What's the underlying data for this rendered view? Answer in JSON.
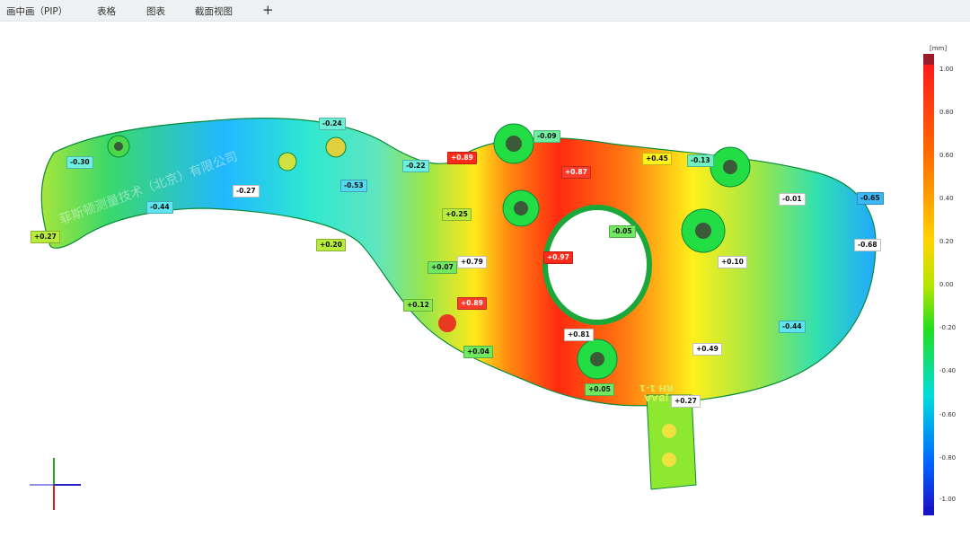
{
  "tabs": [
    "画中画（PIP）",
    "表格",
    "图表",
    "截面视图"
  ],
  "add_tab": "+",
  "watermark": "菲斯顿测量技术（北京）有限公司",
  "part_marking": [
    "JBAA",
    "RH 1-1"
  ],
  "colors": {
    "hot": "#ff2a1a",
    "warm": "#ffd400",
    "neutral": "#22dd22",
    "cold": "#1a7aff"
  },
  "scale": {
    "unit": "[mm]",
    "ticks": [
      "1.00",
      "0.80",
      "0.60",
      "0.40",
      "0.20",
      "0.00",
      "-0.20",
      "-0.40",
      "-0.60",
      "-0.80",
      "-1.00"
    ]
  },
  "deviations": [
    {
      "text": "-0.30",
      "color": "#6ef0e0"
    },
    {
      "text": "-0.44",
      "color": "#5ee6f0"
    },
    {
      "text": "-0.27",
      "color": "#ffffff"
    },
    {
      "text": "+0.27",
      "color": "#b8ec3c"
    },
    {
      "text": "-0.24",
      "color": "#6ef0d8"
    },
    {
      "text": "-0.53",
      "color": "#54d8f0"
    },
    {
      "text": "-0.22",
      "color": "#6ef0e0"
    },
    {
      "text": "+0.20",
      "color": "#b8ec3c"
    },
    {
      "text": "+0.89",
      "color": "#ff2a1a"
    },
    {
      "text": "+0.25",
      "color": "#b8ec3c"
    },
    {
      "text": "+0.07",
      "color": "#70e860"
    },
    {
      "text": "+0.12",
      "color": "#8ee850"
    },
    {
      "text": "+0.79",
      "color": "#ffffff"
    },
    {
      "text": "+0.89",
      "color": "#ff3a2a"
    },
    {
      "text": "+0.04",
      "color": "#70e860"
    },
    {
      "text": "-0.09",
      "color": "#6ef0a0"
    },
    {
      "text": "+0.87",
      "color": "#ff3a2a"
    },
    {
      "text": "+0.97",
      "color": "#ff2a1a"
    },
    {
      "text": "+0.45",
      "color": "#fff21a"
    },
    {
      "text": "-0.13",
      "color": "#6ef0c0"
    },
    {
      "text": "-0.05",
      "color": "#70e860"
    },
    {
      "text": "-0.01",
      "color": "#ffffff"
    },
    {
      "text": "-0.65",
      "color": "#3ab8f8"
    },
    {
      "text": "-0.68",
      "color": "#ffffff"
    },
    {
      "text": "+0.10",
      "color": "#ffffff"
    },
    {
      "text": "-0.44",
      "color": "#5ee6f0"
    },
    {
      "text": "+0.81",
      "color": "#ffffff"
    },
    {
      "text": "+0.49",
      "color": "#ffffff"
    },
    {
      "text": "+0.05",
      "color": "#70e860"
    },
    {
      "text": "+0.27",
      "color": "#ffffff"
    }
  ]
}
